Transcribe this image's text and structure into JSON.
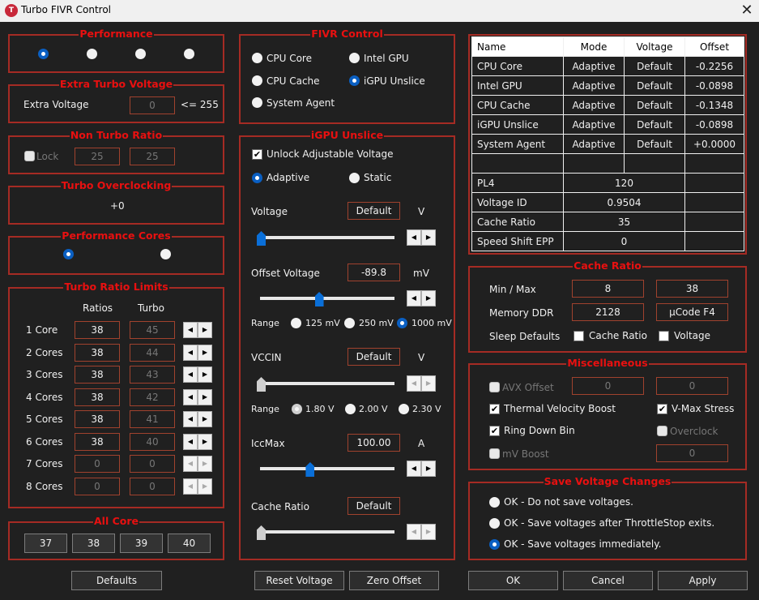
{
  "window": {
    "title": "Turbo FIVR Control",
    "close_icon": "close-icon",
    "app_icon": "throttlestop-icon",
    "app_icon_glyph": "T"
  },
  "performance": {
    "title": "Performance",
    "selected_index": 0,
    "options": 4
  },
  "extra_turbo_voltage": {
    "title": "Extra Turbo Voltage",
    "label": "Extra Voltage",
    "value": "0",
    "limit": "<= 255"
  },
  "non_turbo_ratio": {
    "title": "Non Turbo Ratio",
    "lock_label": "Lock",
    "lock_checked": false,
    "value1": "25",
    "value2": "25"
  },
  "turbo_overclocking": {
    "title": "Turbo Overclocking",
    "value": "+0"
  },
  "performance_cores": {
    "title": "Performance Cores",
    "selected_index": 0
  },
  "turbo_ratio_limits": {
    "title": "Turbo Ratio Limits",
    "col_ratios": "Ratios",
    "col_turbo": "Turbo",
    "rows": [
      {
        "label": "1 Core",
        "ratio": "38",
        "turbo": "45",
        "enabled": true
      },
      {
        "label": "2 Cores",
        "ratio": "38",
        "turbo": "44",
        "enabled": true
      },
      {
        "label": "3 Cores",
        "ratio": "38",
        "turbo": "43",
        "enabled": true
      },
      {
        "label": "4 Cores",
        "ratio": "38",
        "turbo": "42",
        "enabled": true
      },
      {
        "label": "5 Cores",
        "ratio": "38",
        "turbo": "41",
        "enabled": true
      },
      {
        "label": "6 Cores",
        "ratio": "38",
        "turbo": "40",
        "enabled": true
      },
      {
        "label": "7 Cores",
        "ratio": "0",
        "turbo": "0",
        "enabled": false
      },
      {
        "label": "8 Cores",
        "ratio": "0",
        "turbo": "0",
        "enabled": false
      }
    ],
    "spin_left": "◀",
    "spin_right": "▶"
  },
  "all_core": {
    "title": "All Core",
    "buttons": [
      "37",
      "38",
      "39",
      "40"
    ]
  },
  "defaults_button": "Defaults",
  "fivr_control": {
    "title": "FIVR Control",
    "options": [
      {
        "label": "CPU Core",
        "selected": false
      },
      {
        "label": "Intel GPU",
        "selected": false
      },
      {
        "label": "CPU Cache",
        "selected": false
      },
      {
        "label": "iGPU Unslice",
        "selected": true
      },
      {
        "label": "System Agent",
        "selected": false
      }
    ]
  },
  "igpu_unslice": {
    "title": "iGPU Unslice",
    "unlock_label": "Unlock Adjustable Voltage",
    "unlock_checked": true,
    "mode_adaptive": "Adaptive",
    "mode_static": "Static",
    "mode_selected": "Adaptive",
    "voltage_label": "Voltage",
    "voltage_value": "Default",
    "voltage_unit": "V",
    "voltage_slider_fraction": 0.0,
    "offset_label": "Offset Voltage",
    "offset_value": "-89.8",
    "offset_unit": "mV",
    "offset_slider_fraction": 0.45,
    "range_label": "Range",
    "offset_ranges": [
      "125 mV",
      "250 mV",
      "1000 mV"
    ],
    "offset_range_selected": 2,
    "vccin_label": "VCCIN",
    "vccin_value": "Default",
    "vccin_unit": "V",
    "vccin_slider_fraction": 0.0,
    "vccin_ranges": [
      "1.80 V",
      "2.00 V",
      "2.30 V"
    ],
    "vccin_range_selected": 0,
    "iccmax_label": "IccMax",
    "iccmax_value": "100.00",
    "iccmax_unit": "A",
    "iccmax_slider_fraction": 0.38,
    "cache_ratio_label": "Cache Ratio",
    "cache_ratio_value": "Default",
    "cache_ratio_slider_fraction": 0.0
  },
  "reset_voltage_button": "Reset Voltage",
  "zero_offset_button": "Zero Offset",
  "status_table": {
    "headers": [
      "Name",
      "Mode",
      "Voltage",
      "Offset"
    ],
    "rows": [
      [
        "CPU Core",
        "Adaptive",
        "Default",
        "-0.2256"
      ],
      [
        "Intel GPU",
        "Adaptive",
        "Default",
        "-0.0898"
      ],
      [
        "CPU Cache",
        "Adaptive",
        "Default",
        "-0.1348"
      ],
      [
        "iGPU Unslice",
        "Adaptive",
        "Default",
        "-0.0898"
      ],
      [
        "System Agent",
        "Adaptive",
        "Default",
        "+0.0000"
      ],
      [
        "",
        "",
        "",
        ""
      ]
    ],
    "info_rows": [
      [
        "PL4",
        "120"
      ],
      [
        "Voltage ID",
        "0.9504"
      ],
      [
        "Cache Ratio",
        "35"
      ],
      [
        "Speed Shift EPP",
        "0"
      ]
    ]
  },
  "cache_ratio": {
    "title": "Cache Ratio",
    "minmax_label": "Min / Max",
    "min": "8",
    "max": "38",
    "memory_label": "Memory DDR",
    "memory_value": "2128",
    "ucode_value": "µCode F4",
    "sleep_label": "Sleep Defaults",
    "sleep_cache_label": "Cache Ratio",
    "sleep_cache_checked": false,
    "sleep_voltage_label": "Voltage",
    "sleep_voltage_checked": false
  },
  "misc": {
    "title": "Miscellaneous",
    "avx_label": "AVX Offset",
    "avx_checked": false,
    "avx_value1": "0",
    "avx_value2": "0",
    "tvb_label": "Thermal Velocity Boost",
    "tvb_checked": true,
    "vmax_label": "V-Max Stress",
    "vmax_checked": true,
    "ring_label": "Ring Down Bin",
    "ring_checked": true,
    "overclock_label": "Overclock",
    "overclock_checked": false,
    "mvboost_label": "mV Boost",
    "mvboost_checked": false,
    "mvboost_value": "0",
    "check_glyph": "✔"
  },
  "save_voltage": {
    "title": "Save Voltage Changes",
    "options": [
      {
        "label": "OK - Do not save voltages.",
        "selected": false
      },
      {
        "label": "OK - Save voltages after ThrottleStop exits.",
        "selected": false
      },
      {
        "label": "OK - Save voltages immediately.",
        "selected": true
      }
    ]
  },
  "ok_button": "OK",
  "cancel_button": "Cancel",
  "apply_button": "Apply"
}
